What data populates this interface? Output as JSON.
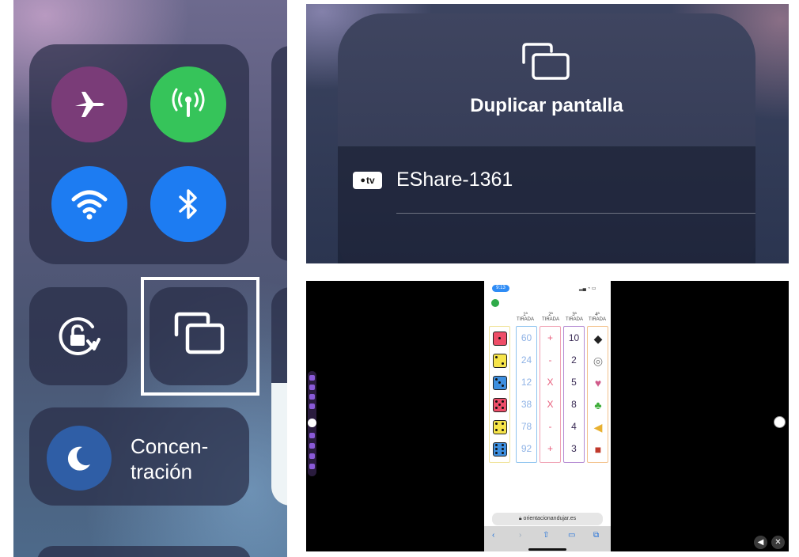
{
  "control_center": {
    "focus_label_line1": "Concen-",
    "focus_label_line2": "tración"
  },
  "mirror_dialog": {
    "title": "Duplicar pantalla",
    "device_badge": "tv",
    "device_name": "EShare-1361"
  },
  "projection": {
    "status_time": "9:13",
    "columns": [
      {
        "head1": "1ª",
        "head2": "TIRADA"
      },
      {
        "head1": "2ª",
        "head2": "TIRADA"
      },
      {
        "head1": "3ª",
        "head2": "TIRADA"
      },
      {
        "head1": "4ª",
        "head2": "TIRADA"
      }
    ],
    "col1": [
      "60",
      "24",
      "12",
      "38",
      "78",
      "92"
    ],
    "col2": [
      "+",
      "-",
      "X",
      "X",
      "-",
      "+"
    ],
    "col3": [
      "10",
      "2",
      "5",
      "8",
      "4",
      "3"
    ],
    "url": "orientacionandujar.es"
  },
  "colors": {
    "airplane": "#7a3c78",
    "cellular": "#36c45a",
    "wifi": "#1d7cf2",
    "bluetooth": "#1d7cf2"
  }
}
